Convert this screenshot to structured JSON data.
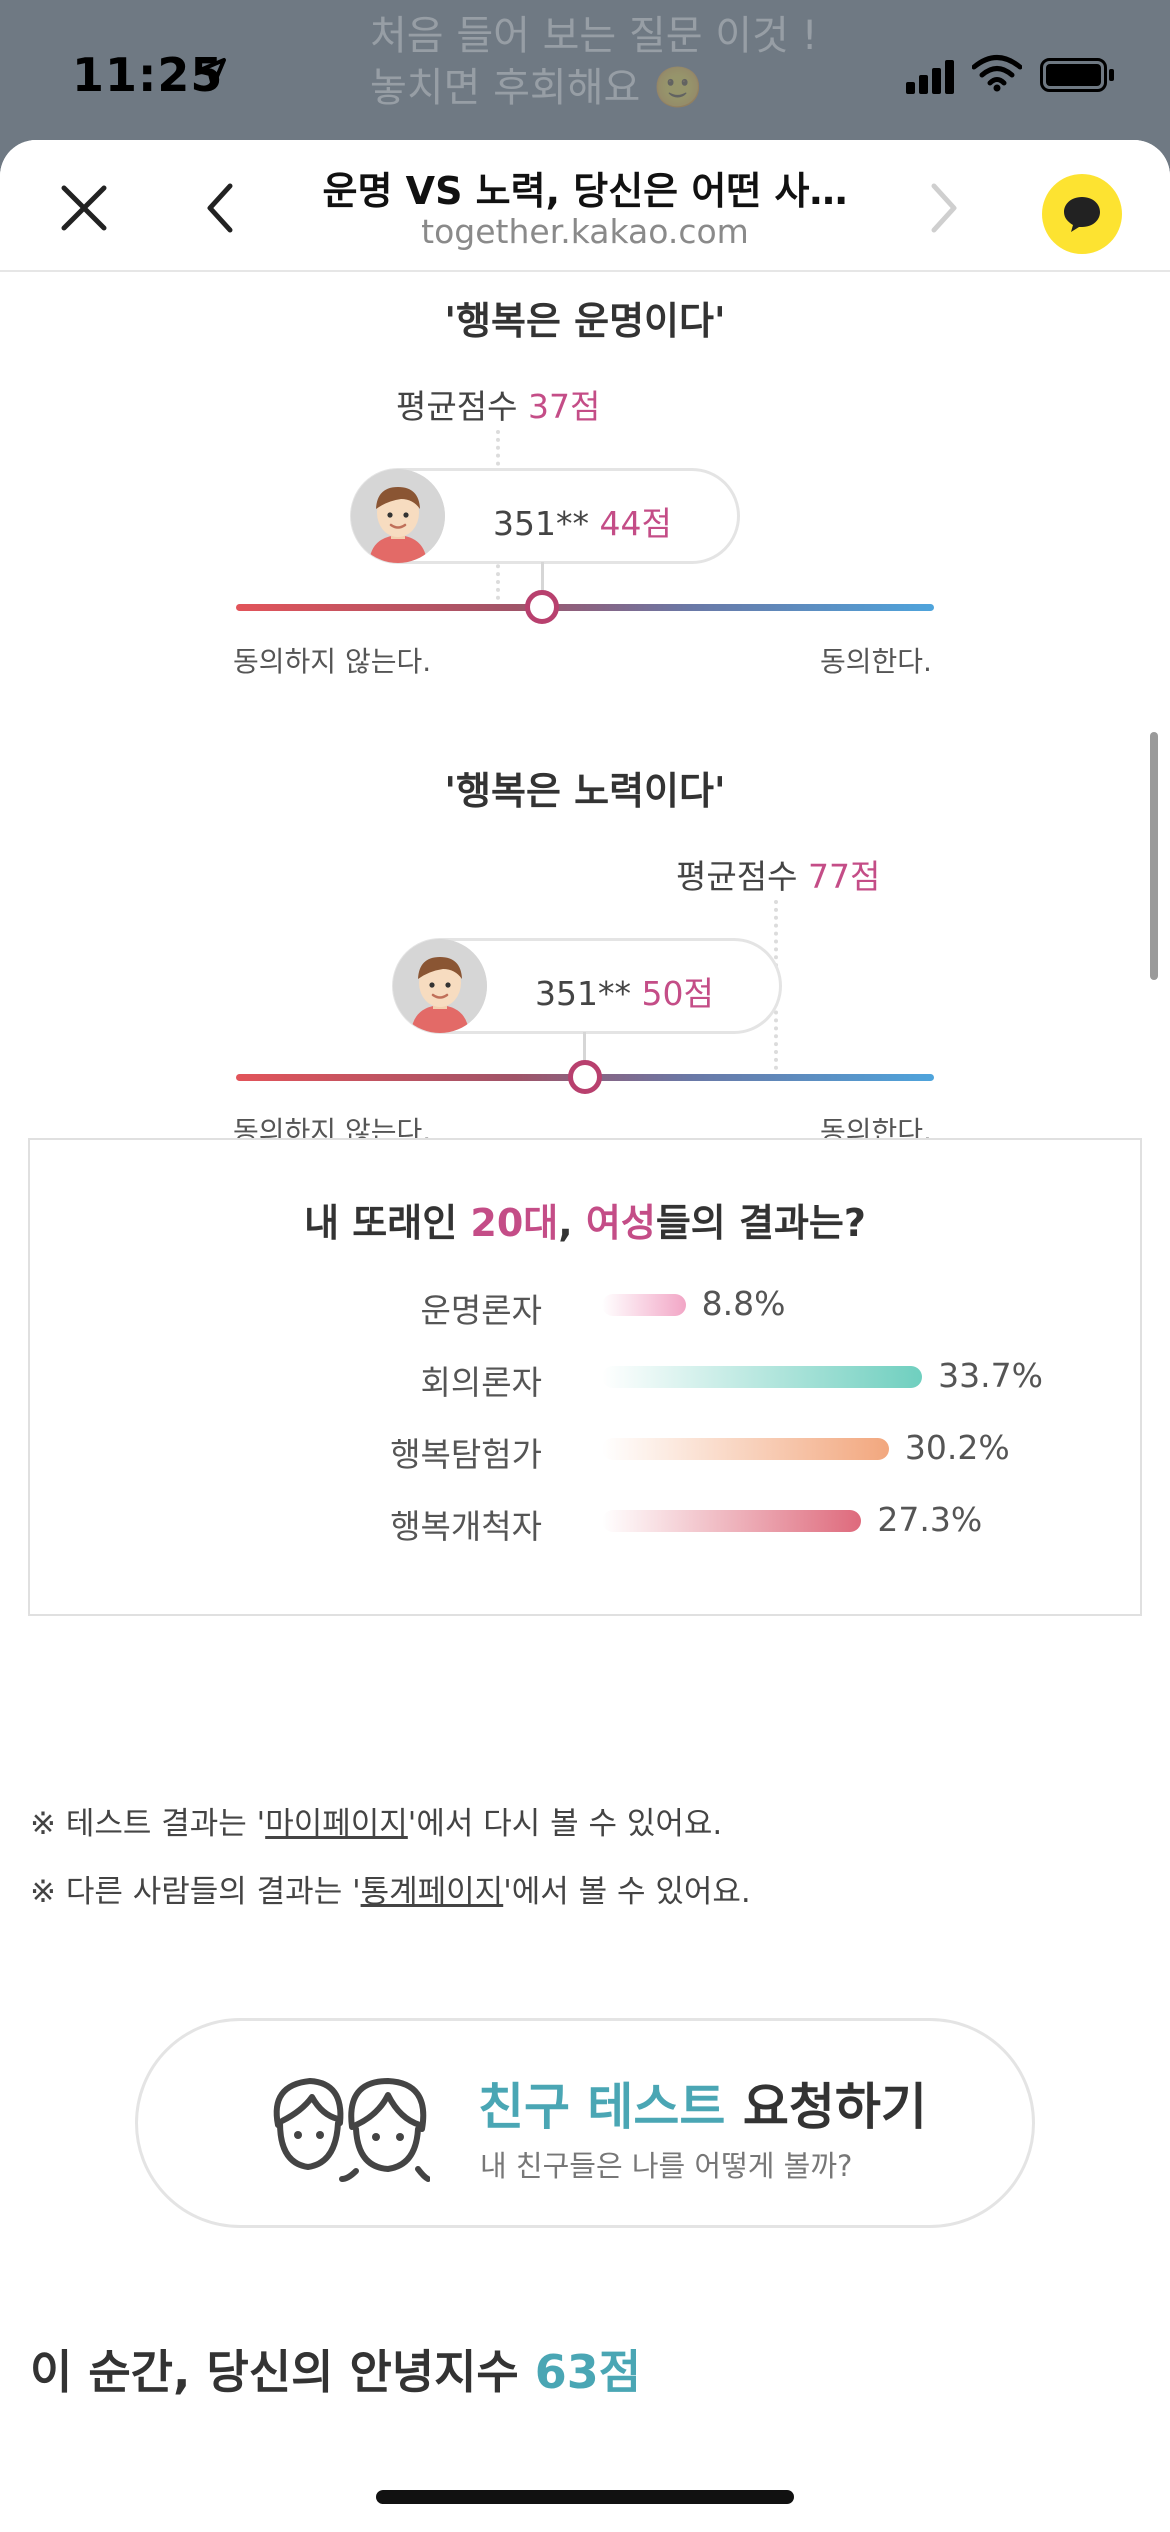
{
  "status": {
    "time": "11:25",
    "background_text_line1": "처음 들어 보는 질문 이것 !",
    "background_text_line2": "놓치면 후회해요 🙂"
  },
  "navbar": {
    "title": "운명 VS 노력, 당신은 어떤 사…",
    "url": "together.kakao.com"
  },
  "question1": {
    "title": "'행복은 운명이다'",
    "avg_label": "평균점수",
    "avg_value": "37점",
    "user_id": "351**",
    "user_score": "44점",
    "position": 0.44,
    "avg_position": 0.37,
    "left_label": "동의하지 않는다.",
    "right_label": "동의한다."
  },
  "question2": {
    "title": "'행복은 노력이다'",
    "avg_label": "평균점수",
    "avg_value": "77점",
    "user_id": "351**",
    "user_score": "50점",
    "position": 0.5,
    "avg_position": 0.77,
    "left_label": "동의하지 않는다.",
    "right_label": "동의한다."
  },
  "stats": {
    "title_pre": "내 또래인 ",
    "title_age": "20대",
    "title_mid": ", ",
    "title_gender": "여성",
    "title_post": "들의 결과는?",
    "rows": [
      {
        "label": "운명론자",
        "value": "8.8%",
        "pct": 8.8,
        "color": "#f2a6c6"
      },
      {
        "label": "회의론자",
        "value": "33.7%",
        "pct": 33.7,
        "color": "#6fcfbf"
      },
      {
        "label": "행복탐험가",
        "value": "30.2%",
        "pct": 30.2,
        "color": "#f2a77e"
      },
      {
        "label": "행복개척자",
        "value": "27.3%",
        "pct": 27.3,
        "color": "#de6a7c"
      }
    ]
  },
  "notes": {
    "note1_pre": "※ 테스트 결과는 '",
    "note1_link": "마이페이지",
    "note1_post": "'에서 다시 볼 수 있어요.",
    "note2_pre": "※ 다른 사람들의 결과는 '",
    "note2_link": "통계페이지",
    "note2_post": "'에서 볼 수 있어요."
  },
  "friend": {
    "main_highlight": "친구 테스트",
    "main_rest": " 요청하기",
    "sub": "내 친구들은 나를 어떻게 볼까?"
  },
  "score": {
    "text": "이 순간, 당신의 안녕지수 ",
    "value": "63점"
  }
}
